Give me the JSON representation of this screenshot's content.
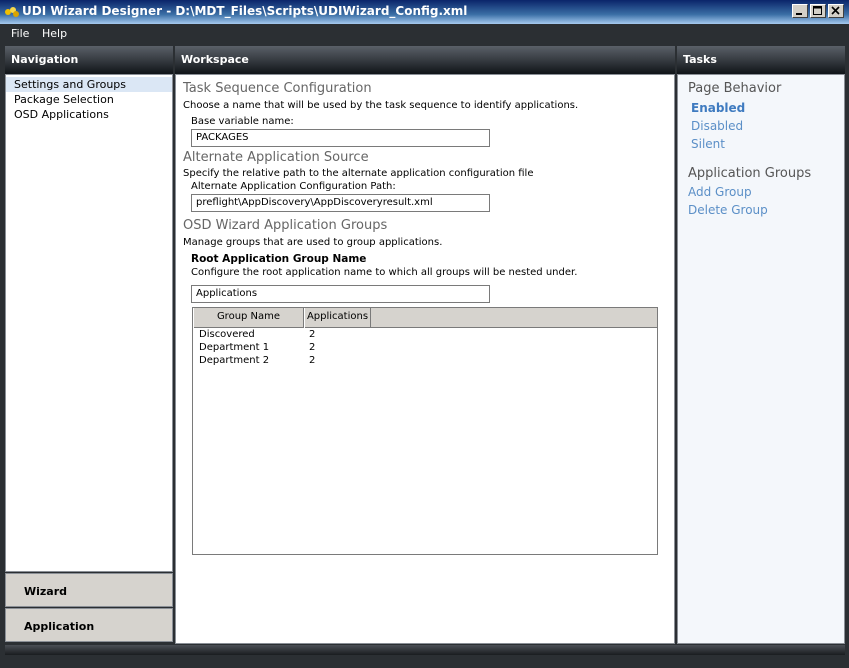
{
  "window": {
    "title": "UDI Wizard Designer - D:\\MDT_Files\\Scripts\\UDIWizard_Config.xml"
  },
  "menu": [
    "File",
    "Help"
  ],
  "navigation": {
    "header": "Navigation",
    "items": [
      "Settings and Groups",
      "Package Selection",
      "OSD Applications"
    ],
    "selected": "Settings and Groups",
    "buttons": [
      "Wizard",
      "Application"
    ]
  },
  "workspace": {
    "header": "Workspace",
    "task_sequence": {
      "title": "Task Sequence Configuration",
      "description": "Choose a name that will be used by the task sequence to identify applications.",
      "field_label": "Base variable name:",
      "field_value": "PACKAGES"
    },
    "alternate_source": {
      "title": "Alternate Application Source",
      "description": "Specify the relative path to the alternate application configuration file",
      "field_label": "Alternate Application Configuration Path:",
      "field_value": "preflight\\AppDiscovery\\AppDiscoveryresult.xml"
    },
    "groups": {
      "title": "OSD Wizard Application Groups",
      "description": "Manage groups that are used to group applications.",
      "root_label": "Root Application Group Name",
      "root_description": "Configure the root application name to which all groups will be nested under.",
      "root_value": "Applications",
      "columns": [
        "Group Name",
        "Applications"
      ],
      "rows": [
        {
          "name": "Discovered",
          "count": "2"
        },
        {
          "name": "Department 1",
          "count": "2"
        },
        {
          "name": "Department 2",
          "count": "2"
        }
      ]
    }
  },
  "tasks": {
    "header": "Tasks",
    "page_behavior": {
      "title": "Page Behavior",
      "options": [
        "Enabled",
        "Disabled",
        "Silent"
      ],
      "active": "Enabled"
    },
    "application_groups": {
      "title": "Application Groups",
      "links": [
        "Add Group",
        "Delete Group"
      ]
    }
  },
  "colors": {
    "chrome": "#2b2f33",
    "link": "#5b8fc7",
    "selection": "#dbe7f5"
  }
}
